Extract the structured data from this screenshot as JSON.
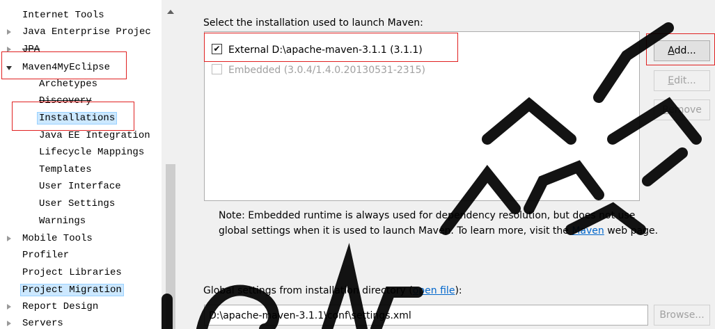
{
  "tree": {
    "items": [
      {
        "label": "Internet Tools"
      },
      {
        "label": "Java Enterprise Projec"
      },
      {
        "label": "JPA"
      },
      {
        "label": "Maven4MyEclipse"
      },
      {
        "label": "Archetypes"
      },
      {
        "label": "Discovery"
      },
      {
        "label": "Installations"
      },
      {
        "label": "Java EE Integration"
      },
      {
        "label": "Lifecycle Mappings"
      },
      {
        "label": "Templates"
      },
      {
        "label": "User Interface"
      },
      {
        "label": "User Settings"
      },
      {
        "label": "Warnings"
      },
      {
        "label": "Mobile Tools"
      },
      {
        "label": "Profiler"
      },
      {
        "label": "Project Libraries"
      },
      {
        "label": "Project Migration"
      },
      {
        "label": "Report Design"
      },
      {
        "label": "Servers"
      }
    ]
  },
  "panel": {
    "heading": "Select the installation used to launch Maven:",
    "installations": [
      {
        "label": "External D:\\apache-maven-3.1.1 (3.1.1)",
        "checked": true,
        "enabled": true,
        "mark": "✔"
      },
      {
        "label": "Embedded (3.0.4/1.4.0.20130531-2315)",
        "checked": false,
        "enabled": false,
        "mark": ""
      }
    ],
    "buttons": {
      "add": {
        "key": "A",
        "rest": "dd..."
      },
      "edit": {
        "key": "E",
        "rest": "dit..."
      },
      "remove": {
        "key": "R",
        "rest": "emove"
      }
    },
    "note": {
      "part1": "Note: Embedded runtime is always used for dependency resolution, but does not use global settings when it is used to launch Maven. To learn more, visit the ",
      "link": "Maven",
      "part2": " web page."
    },
    "global_settings": {
      "label_prefix": "Global settings from installation directory (",
      "link": "open file",
      "label_suffix": "):",
      "value": "D:\\apache-maven-3.1.1\\conf\\settings.xml",
      "browse": "Browse..."
    }
  },
  "colors": {
    "highlight": "#e02020",
    "selection": "#cce8ff",
    "link": "#0066cc",
    "panel_bg": "#f0f0f0"
  }
}
